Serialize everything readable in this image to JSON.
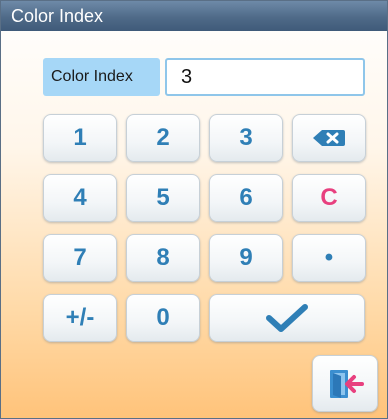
{
  "window": {
    "title": "Color Index"
  },
  "field": {
    "label": "Color Index",
    "value": "3"
  },
  "keypad": {
    "keys": [
      "1",
      "2",
      "3",
      "4",
      "5",
      "6",
      "C",
      "7",
      "8",
      "9",
      "•",
      "+/-",
      "0"
    ],
    "backspace_icon": "backspace-icon",
    "confirm_icon": "check-icon"
  },
  "exit": {
    "icon": "exit-door-icon"
  },
  "colors": {
    "title_bar": "#4f6a88",
    "key_text": "#2f7fb6",
    "clear_key_text": "#e8407f",
    "label_bg": "#a6d7f7",
    "input_border": "#8fc6ea",
    "exit_arrow": "#e8407f"
  }
}
